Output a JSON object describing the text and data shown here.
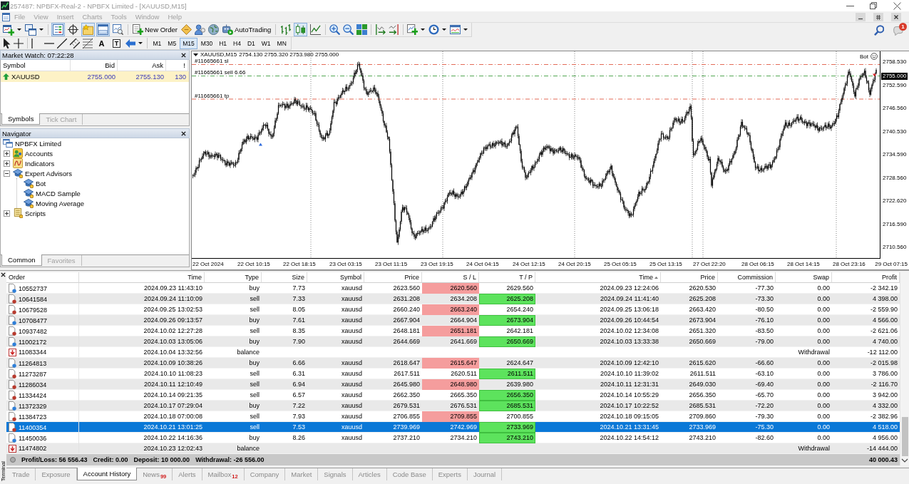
{
  "window": {
    "title": "257487: NPBFX-Real-2 - NPBFX Limited - [XAUUSD,M15]"
  },
  "menu": [
    "File",
    "View",
    "Insert",
    "Charts",
    "Tools",
    "Window",
    "Help"
  ],
  "toolbar": {
    "toggles": [
      {
        "pressed": true
      },
      {
        "pressed": false
      },
      {
        "pressed": true
      },
      {
        "pressed": true
      },
      {
        "pressed": false
      }
    ],
    "new_order": "New Order",
    "autotrading": "AutoTrading",
    "chart_types": [
      {
        "selected": false
      },
      {
        "selected": true
      },
      {
        "selected": false
      }
    ],
    "notification_count": "1"
  },
  "drawing_toolbar": {
    "text_tools": [
      "A",
      "T"
    ],
    "timeframes": [
      {
        "label": "M1",
        "selected": false
      },
      {
        "label": "M5",
        "selected": false
      },
      {
        "label": "M15",
        "selected": true
      },
      {
        "label": "M30",
        "selected": false
      },
      {
        "label": "H1",
        "selected": false
      },
      {
        "label": "H4",
        "selected": false
      },
      {
        "label": "D1",
        "selected": false
      },
      {
        "label": "W1",
        "selected": false
      },
      {
        "label": "MN",
        "selected": false
      }
    ]
  },
  "market_watch": {
    "title": "Market Watch: 07:22:28",
    "columns": [
      "Symbol",
      "Bid",
      "Ask",
      "!"
    ],
    "rows": [
      {
        "symbol": "XAUUSD",
        "bid": "2755.000",
        "ask": "2755.130",
        "spread": "130",
        "selected": true
      }
    ],
    "tabs": [
      {
        "label": "Symbols",
        "selected": true
      },
      {
        "label": "Tick Chart",
        "selected": false
      }
    ]
  },
  "navigator": {
    "title": "Navigator",
    "root": "NPBFX Limited",
    "items": [
      {
        "kind": "accounts",
        "label": "Accounts",
        "expanded": false
      },
      {
        "kind": "indicators",
        "label": "Indicators",
        "expanded": false
      },
      {
        "kind": "experts",
        "label": "Expert Advisors",
        "expanded": true,
        "children": [
          {
            "label": "Bot"
          },
          {
            "label": "MACD Sample"
          },
          {
            "label": "Moving Average"
          }
        ]
      },
      {
        "kind": "scripts",
        "label": "Scripts",
        "expanded": false
      }
    ],
    "tabs": [
      {
        "label": "Common",
        "selected": true
      },
      {
        "label": "Favorites",
        "selected": false
      }
    ]
  },
  "chart": {
    "symbol": "XAUUSD,M15",
    "ohlc": "2754.130 2755.320 2753.980 2755.000",
    "expert": "Bot",
    "order_lines": [
      {
        "kind": "sl",
        "label": "#11665661 sl"
      },
      {
        "kind": "entry",
        "label": "#11665661 sell 6.66"
      },
      {
        "kind": "tp",
        "label": "#11665661 tp"
      }
    ],
    "price_labels": [
      "2758.530",
      "2752.590",
      "2746.560",
      "2740.530",
      "2734.590",
      "2728.560",
      "2722.620",
      "2716.590",
      "2710.560"
    ],
    "current_price": "2755.000",
    "time_labels": [
      "22 Oct 2024",
      "22 Oct 10:15",
      "22 Oct 18:15",
      "23 Oct 03:15",
      "23 Oct 11:15",
      "23 Oct 19:15",
      "24 Oct 04:15",
      "24 Oct 12:15",
      "24 Oct 20:15",
      "25 Oct 05:15",
      "25 Oct 13:15",
      "27 Oct 22:20",
      "28 Oct 06:15",
      "28 Oct 14:15",
      "28 Oct 23:16",
      "29 Oct 07:15"
    ]
  },
  "terminal": {
    "side_label": "Terminal",
    "columns": [
      "Order",
      "Time",
      "Type",
      "Size",
      "Symbol",
      "Price",
      "S / L",
      "T / P",
      "Time",
      "Price",
      "Commission",
      "Swap",
      "Profit"
    ],
    "rows": [
      {
        "kind": "buy",
        "selected": false,
        "sl_hit": true,
        "tp_hit": false,
        "order": "10552737",
        "time": "2024.09.23 11:43:10",
        "type": "buy",
        "size": "7.73",
        "symbol": "xauusd",
        "price": "2623.560",
        "sl": "2620.560",
        "tp": "2629.560",
        "close_time": "2024.09.23 12:24:06",
        "close_price": "2620.530",
        "commission": "-77.30",
        "swap": "0.00",
        "profit": "-2 342.19"
      },
      {
        "kind": "sell",
        "selected": false,
        "sl_hit": false,
        "tp_hit": true,
        "order": "10641584",
        "time": "2024.09.24 11:10:09",
        "type": "sell",
        "size": "7.33",
        "symbol": "xauusd",
        "price": "2631.208",
        "sl": "2634.208",
        "tp": "2625.208",
        "close_time": "2024.09.24 11:41:40",
        "close_price": "2625.208",
        "commission": "-73.30",
        "swap": "0.00",
        "profit": "4 398.00"
      },
      {
        "kind": "sell",
        "selected": false,
        "sl_hit": true,
        "tp_hit": false,
        "order": "10679528",
        "time": "2024.09.25 13:02:53",
        "type": "sell",
        "size": "8.05",
        "symbol": "xauusd",
        "price": "2660.240",
        "sl": "2663.240",
        "tp": "2654.240",
        "close_time": "2024.09.25 13:06:18",
        "close_price": "2663.420",
        "commission": "-80.50",
        "swap": "0.00",
        "profit": "-2 559.90"
      },
      {
        "kind": "buy",
        "selected": false,
        "sl_hit": false,
        "tp_hit": true,
        "order": "10708477",
        "time": "2024.09.26 09:13:57",
        "type": "buy",
        "size": "7.61",
        "symbol": "xauusd",
        "price": "2667.904",
        "sl": "2664.904",
        "tp": "2673.904",
        "close_time": "2024.09.26 10:44:54",
        "close_price": "2673.904",
        "commission": "-76.10",
        "swap": "0.00",
        "profit": "4 566.00"
      },
      {
        "kind": "sell",
        "selected": false,
        "sl_hit": true,
        "tp_hit": false,
        "order": "10937482",
        "time": "2024.10.02 12:27:28",
        "type": "sell",
        "size": "8.35",
        "symbol": "xauusd",
        "price": "2648.181",
        "sl": "2651.181",
        "tp": "2642.181",
        "close_time": "2024.10.02 12:34:08",
        "close_price": "2651.320",
        "commission": "-83.50",
        "swap": "0.00",
        "profit": "-2 621.06"
      },
      {
        "kind": "buy",
        "selected": false,
        "sl_hit": false,
        "tp_hit": true,
        "order": "11002172",
        "time": "2024.10.03 13:05:06",
        "type": "buy",
        "size": "7.90",
        "symbol": "xauusd",
        "price": "2644.669",
        "sl": "2641.669",
        "tp": "2650.669",
        "close_time": "2024.10.03 13:33:38",
        "close_price": "2650.669",
        "commission": "-79.00",
        "swap": "0.00",
        "profit": "4 740.00"
      },
      {
        "kind": "balance",
        "selected": false,
        "order": "11083344",
        "time": "2024.10.04 13:32:56",
        "type": "balance",
        "comment": "Withdrawal",
        "profit": "-12 112.00"
      },
      {
        "kind": "buy",
        "selected": false,
        "sl_hit": true,
        "tp_hit": false,
        "order": "11264813",
        "time": "2024.10.09 10:38:26",
        "type": "buy",
        "size": "6.66",
        "symbol": "xauusd",
        "price": "2618.647",
        "sl": "2615.647",
        "tp": "2624.647",
        "close_time": "2024.10.09 12:42:10",
        "close_price": "2615.620",
        "commission": "-66.60",
        "swap": "0.00",
        "profit": "-2 015.98"
      },
      {
        "kind": "sell",
        "selected": false,
        "sl_hit": false,
        "tp_hit": true,
        "order": "11273287",
        "time": "2024.10.10 11:08:23",
        "type": "sell",
        "size": "6.31",
        "symbol": "xauusd",
        "price": "2617.511",
        "sl": "2620.511",
        "tp": "2611.511",
        "close_time": "2024.10.10 11:39:02",
        "close_price": "2611.511",
        "commission": "-63.10",
        "swap": "0.00",
        "profit": "3 786.00"
      },
      {
        "kind": "sell",
        "selected": false,
        "sl_hit": true,
        "tp_hit": false,
        "order": "11286034",
        "time": "2024.10.11 12:10:49",
        "type": "sell",
        "size": "6.94",
        "symbol": "xauusd",
        "price": "2645.980",
        "sl": "2648.980",
        "tp": "2639.980",
        "close_time": "2024.10.11 12:31:31",
        "close_price": "2649.030",
        "commission": "-69.40",
        "swap": "0.00",
        "profit": "-2 116.70"
      },
      {
        "kind": "sell",
        "selected": false,
        "sl_hit": false,
        "tp_hit": true,
        "order": "11334424",
        "time": "2024.10.14 09:21:35",
        "type": "sell",
        "size": "6.57",
        "symbol": "xauusd",
        "price": "2662.350",
        "sl": "2665.350",
        "tp": "2656.350",
        "close_time": "2024.10.14 10:55:29",
        "close_price": "2656.350",
        "commission": "-65.70",
        "swap": "0.00",
        "profit": "3 942.00"
      },
      {
        "kind": "buy",
        "selected": false,
        "sl_hit": false,
        "tp_hit": true,
        "order": "11372329",
        "time": "2024.10.17 07:29:04",
        "type": "buy",
        "size": "7.22",
        "symbol": "xauusd",
        "price": "2679.531",
        "sl": "2676.531",
        "tp": "2685.531",
        "close_time": "2024.10.17 10:22:52",
        "close_price": "2685.531",
        "commission": "-72.20",
        "swap": "0.00",
        "profit": "4 332.00"
      },
      {
        "kind": "sell",
        "selected": false,
        "sl_hit": true,
        "tp_hit": false,
        "order": "11384723",
        "time": "2024.10.18 07:00:08",
        "type": "sell",
        "size": "7.93",
        "symbol": "xauusd",
        "price": "2706.855",
        "sl": "2709.855",
        "tp": "2700.855",
        "close_time": "2024.10.18 09:15:05",
        "close_price": "2709.860",
        "commission": "-79.30",
        "swap": "0.00",
        "profit": "-2 382.96"
      },
      {
        "kind": "sell",
        "selected": true,
        "sl_hit": false,
        "tp_hit": true,
        "order": "11400354",
        "time": "2024.10.21 13:01:25",
        "type": "sell",
        "size": "7.53",
        "symbol": "xauusd",
        "price": "2739.969",
        "sl": "2742.969",
        "tp": "2733.969",
        "close_time": "2024.10.21 13:31:45",
        "close_price": "2733.969",
        "commission": "-75.30",
        "swap": "0.00",
        "profit": "4 518.00"
      },
      {
        "kind": "buy",
        "selected": false,
        "sl_hit": false,
        "tp_hit": true,
        "order": "11450036",
        "time": "2024.10.22 14:16:36",
        "type": "buy",
        "size": "8.26",
        "symbol": "xauusd",
        "price": "2737.210",
        "sl": "2734.210",
        "tp": "2743.210",
        "close_time": "2024.10.22 14:54:12",
        "close_price": "2743.210",
        "commission": "-82.60",
        "swap": "0.00",
        "profit": "4 956.00"
      },
      {
        "kind": "balance",
        "selected": false,
        "order": "11474802",
        "time": "2024.10.23 12:02:43",
        "type": "balance",
        "comment": "Withdrawal",
        "profit": "-14 444.00"
      }
    ],
    "summary": [
      "Profit/Loss: 56 556.43",
      "Credit: 0.00",
      "Deposit: 10 000.00",
      "Withdrawal: -26 556.00"
    ],
    "total": "40 000.43",
    "tabs": [
      {
        "label": "Trade",
        "selected": false
      },
      {
        "label": "Exposure",
        "selected": false
      },
      {
        "label": "Account History",
        "selected": true
      },
      {
        "label": "News",
        "badge": "99",
        "selected": false
      },
      {
        "label": "Alerts",
        "selected": false
      },
      {
        "label": "Mailbox",
        "badge": "12",
        "selected": false
      },
      {
        "label": "Company",
        "selected": false
      },
      {
        "label": "Market",
        "selected": false
      },
      {
        "label": "Signals",
        "selected": false
      },
      {
        "label": "Articles",
        "selected": false
      },
      {
        "label": "Code Base",
        "selected": false
      },
      {
        "label": "Experts",
        "selected": false
      },
      {
        "label": "Journal",
        "selected": false
      }
    ]
  }
}
